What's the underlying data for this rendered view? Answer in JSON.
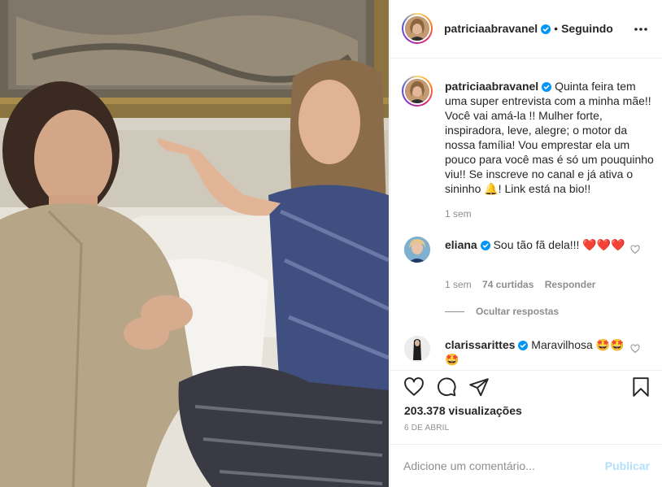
{
  "post": {
    "author": "patriciaabravanel",
    "follow_sep": "•",
    "follow_status": "Seguindo"
  },
  "caption": {
    "username": "patriciaabravanel",
    "text": "Quinta feira tem uma super entrevista com a minha mãe!! Você vai amá-la !! Mulher forte, inspiradora, leve, alegre; o motor da nossa família! Vou emprestar ela um pouco para você mas é só um pouquinho viu!! Se inscreve no canal e já ativa o sininho 🔔! Link está na bio!!",
    "time": "1 sem"
  },
  "comments": [
    {
      "username": "eliana",
      "text": "Sou tão fã dela!!! ❤️❤️❤️",
      "time": "1 sem",
      "likes": "74 curtidas",
      "reply": "Responder",
      "hide_replies": "Ocultar respostas"
    },
    {
      "username": "clarissarittes",
      "text": "Maravilhosa 🤩🤩🤩"
    }
  ],
  "stats": {
    "views": "203.378 visualizações",
    "date": "6 DE ABRIL"
  },
  "add_comment": {
    "placeholder": "Adicione um comentário...",
    "publish": "Publicar"
  },
  "colors": {
    "verified": "#0095f6",
    "link_disabled": "#b2dffc",
    "muted": "#8e8e8e",
    "text": "#262626"
  },
  "icons": {
    "like": "heart-icon",
    "comment": "comment-icon",
    "share": "paper-plane-icon",
    "save": "bookmark-icon",
    "more": "more-dots-icon",
    "verified": "verified-badge-icon"
  }
}
